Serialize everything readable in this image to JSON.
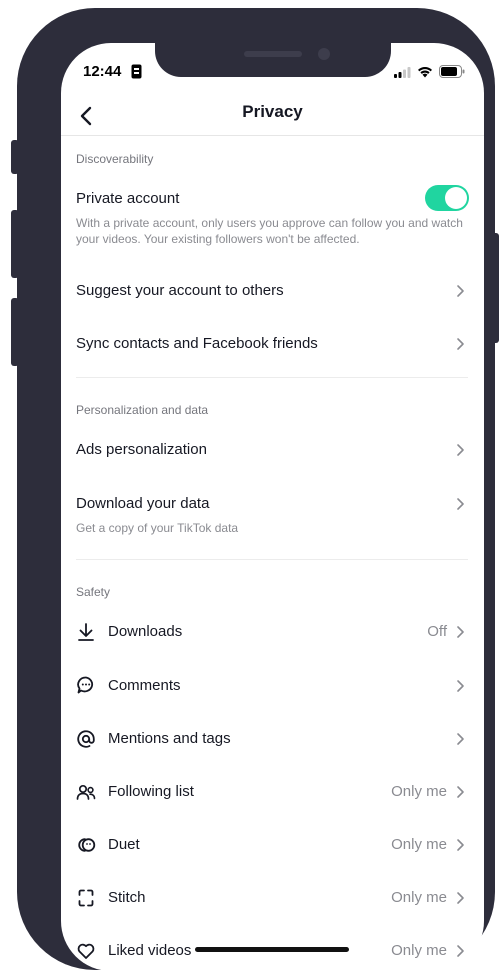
{
  "status_bar": {
    "time": "12:44"
  },
  "nav": {
    "title": "Privacy"
  },
  "discoverability": {
    "header": "Discoverability",
    "private_account": {
      "label": "Private account",
      "enabled": true,
      "description": "With a private account, only users you approve can follow you and watch your videos. Your existing followers won't be affected."
    },
    "suggest": {
      "label": "Suggest your account to others"
    },
    "sync": {
      "label": "Sync contacts and Facebook friends"
    }
  },
  "personalization": {
    "header": "Personalization and data",
    "ads": {
      "label": "Ads personalization"
    },
    "download": {
      "label": "Download your data",
      "description": "Get a copy of your TikTok data"
    }
  },
  "safety": {
    "header": "Safety",
    "items": [
      {
        "label": "Downloads",
        "value": "Off",
        "icon": "download-icon"
      },
      {
        "label": "Comments",
        "value": "",
        "icon": "comment-icon"
      },
      {
        "label": "Mentions and tags",
        "value": "",
        "icon": "at-icon"
      },
      {
        "label": "Following list",
        "value": "Only me",
        "icon": "users-icon"
      },
      {
        "label": "Duet",
        "value": "Only me",
        "icon": "duet-icon"
      },
      {
        "label": "Stitch",
        "value": "Only me",
        "icon": "stitch-icon"
      },
      {
        "label": "Liked videos",
        "value": "Only me",
        "icon": "heart-icon"
      }
    ]
  },
  "colors": {
    "toggle_on": "#20d5a0",
    "frame": "#2d2d3b"
  }
}
